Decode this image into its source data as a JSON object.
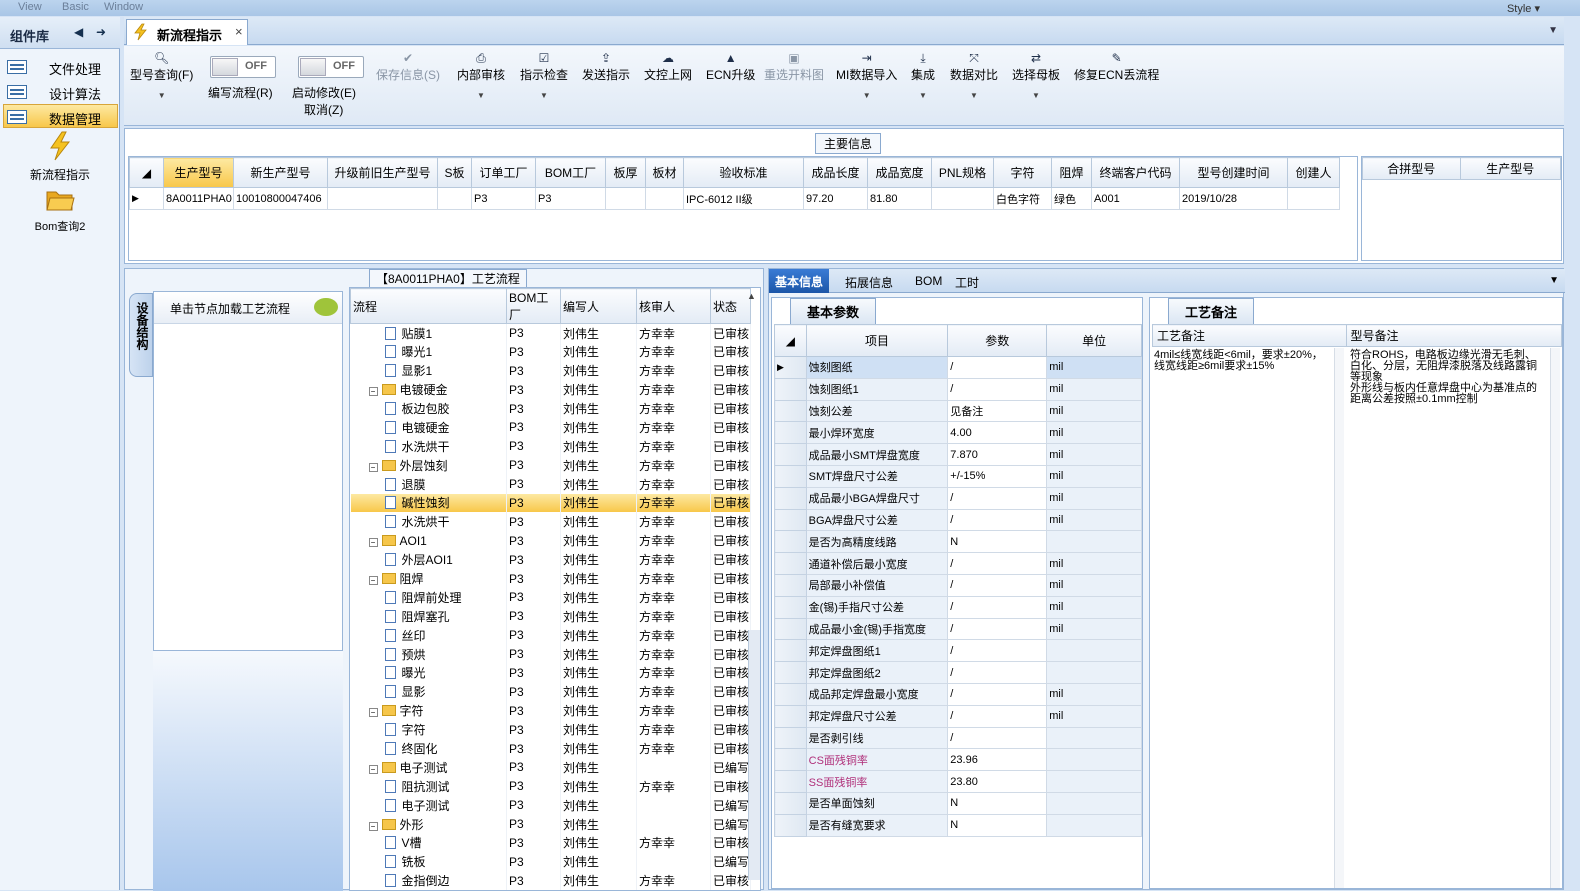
{
  "topbar": {
    "menu": [
      "View",
      "Basic",
      "Window"
    ],
    "style_label": "Style"
  },
  "left_panel": {
    "title": "组件库",
    "items": [
      {
        "label": "文件处理"
      },
      {
        "label": "设计算法"
      },
      {
        "label": "数据管理"
      }
    ],
    "big_items": [
      {
        "label": "新流程指示"
      },
      {
        "label": "Bom查询2"
      }
    ]
  },
  "tab": {
    "label": "新流程指示"
  },
  "toolbar": {
    "buttons": [
      {
        "label": "型号查询(F)"
      },
      {
        "label": "编写流程(R)"
      },
      {
        "label": "启动修改(E)"
      },
      {
        "label": "取消(Z)"
      },
      {
        "label": "保存信息(S)"
      },
      {
        "label": "内部审核"
      },
      {
        "label": "指示检查"
      },
      {
        "label": "发送指示"
      },
      {
        "label": "文控上网"
      },
      {
        "label": "ECN升级"
      },
      {
        "label": "重选开料图"
      },
      {
        "label": "MI数据导入"
      },
      {
        "label": "集成"
      },
      {
        "label": "数据对比"
      },
      {
        "label": "选择母板"
      },
      {
        "label": "修复ECN丢流程"
      }
    ],
    "toggle_state": "OFF"
  },
  "main_info": {
    "legend": "主要信息",
    "columns": [
      "生产型号",
      "新生产型号",
      "升级前旧生产型号",
      "S板",
      "订单工厂",
      "BOM工厂",
      "板厚",
      "板材",
      "验收标准",
      "成品长度",
      "成品宽度",
      "PNL规格",
      "字符",
      "阻焊",
      "终端客户代码",
      "型号创建时间",
      "创建人"
    ],
    "row": [
      "8A0011PHA0",
      "10010800047406",
      "",
      "",
      "P3",
      "P3",
      "",
      "",
      "IPC-6012 II级",
      "97.20",
      "81.80",
      "",
      "白色字符",
      "绿色",
      "A001",
      "2019/10/28",
      ""
    ],
    "side_columns": [
      "合拼型号",
      "生产型号"
    ]
  },
  "process": {
    "legend": "【8A0011PHA0】工艺流程",
    "side_tab": "设备结构",
    "node_hint": "单击节点加载工艺流程",
    "columns": [
      "流程",
      "BOM工厂",
      "编写人",
      "核审人",
      "状态"
    ],
    "rows": [
      {
        "name": "贴膜1",
        "folder": false,
        "bom": "P3",
        "writer": "刘伟生",
        "reviewer": "方幸幸",
        "status": "已审核"
      },
      {
        "name": "曝光1",
        "folder": false,
        "bom": "P3",
        "writer": "刘伟生",
        "reviewer": "方幸幸",
        "status": "已审核"
      },
      {
        "name": "显影1",
        "folder": false,
        "bom": "P3",
        "writer": "刘伟生",
        "reviewer": "方幸幸",
        "status": "已审核"
      },
      {
        "name": "电镀硬金",
        "folder": true,
        "bom": "P3",
        "writer": "刘伟生",
        "reviewer": "方幸幸",
        "status": "已审核"
      },
      {
        "name": "板边包胶",
        "folder": false,
        "bom": "P3",
        "writer": "刘伟生",
        "reviewer": "方幸幸",
        "status": "已审核"
      },
      {
        "name": "电镀硬金",
        "folder": false,
        "bom": "P3",
        "writer": "刘伟生",
        "reviewer": "方幸幸",
        "status": "已审核"
      },
      {
        "name": "水洗烘干",
        "folder": false,
        "bom": "P3",
        "writer": "刘伟生",
        "reviewer": "方幸幸",
        "status": "已审核"
      },
      {
        "name": "外层蚀刻",
        "folder": true,
        "bom": "P3",
        "writer": "刘伟生",
        "reviewer": "方幸幸",
        "status": "已审核"
      },
      {
        "name": "退膜",
        "folder": false,
        "bom": "P3",
        "writer": "刘伟生",
        "reviewer": "方幸幸",
        "status": "已审核"
      },
      {
        "name": "碱性蚀刻",
        "folder": false,
        "bom": "P3",
        "writer": "刘伟生",
        "reviewer": "方幸幸",
        "status": "已审核",
        "selected": true
      },
      {
        "name": "水洗烘干",
        "folder": false,
        "bom": "P3",
        "writer": "刘伟生",
        "reviewer": "方幸幸",
        "status": "已审核"
      },
      {
        "name": "AOI1",
        "folder": true,
        "bom": "P3",
        "writer": "刘伟生",
        "reviewer": "方幸幸",
        "status": "已审核"
      },
      {
        "name": "外层AOI1",
        "folder": false,
        "bom": "P3",
        "writer": "刘伟生",
        "reviewer": "方幸幸",
        "status": "已审核"
      },
      {
        "name": "阻焊",
        "folder": true,
        "bom": "P3",
        "writer": "刘伟生",
        "reviewer": "方幸幸",
        "status": "已审核"
      },
      {
        "name": "阻焊前处理",
        "folder": false,
        "bom": "P3",
        "writer": "刘伟生",
        "reviewer": "方幸幸",
        "status": "已审核"
      },
      {
        "name": "阻焊塞孔",
        "folder": false,
        "bom": "P3",
        "writer": "刘伟生",
        "reviewer": "方幸幸",
        "status": "已审核"
      },
      {
        "name": "丝印",
        "folder": false,
        "bom": "P3",
        "writer": "刘伟生",
        "reviewer": "方幸幸",
        "status": "已审核"
      },
      {
        "name": "预烘",
        "folder": false,
        "bom": "P3",
        "writer": "刘伟生",
        "reviewer": "方幸幸",
        "status": "已审核"
      },
      {
        "name": "曝光",
        "folder": false,
        "bom": "P3",
        "writer": "刘伟生",
        "reviewer": "方幸幸",
        "status": "已审核"
      },
      {
        "name": "显影",
        "folder": false,
        "bom": "P3",
        "writer": "刘伟生",
        "reviewer": "方幸幸",
        "status": "已审核"
      },
      {
        "name": "字符",
        "folder": true,
        "bom": "P3",
        "writer": "刘伟生",
        "reviewer": "方幸幸",
        "status": "已审核"
      },
      {
        "name": "字符",
        "folder": false,
        "bom": "P3",
        "writer": "刘伟生",
        "reviewer": "方幸幸",
        "status": "已审核"
      },
      {
        "name": "终固化",
        "folder": false,
        "bom": "P3",
        "writer": "刘伟生",
        "reviewer": "方幸幸",
        "status": "已审核"
      },
      {
        "name": "电子测试",
        "folder": true,
        "bom": "P3",
        "writer": "刘伟生",
        "reviewer": "",
        "status": "已编写"
      },
      {
        "name": "阻抗测试",
        "folder": false,
        "bom": "P3",
        "writer": "刘伟生",
        "reviewer": "方幸幸",
        "status": "已审核"
      },
      {
        "name": "电子测试",
        "folder": false,
        "bom": "P3",
        "writer": "刘伟生",
        "reviewer": "",
        "status": "已编写"
      },
      {
        "name": "外形",
        "folder": true,
        "bom": "P3",
        "writer": "刘伟生",
        "reviewer": "",
        "status": "已编写"
      },
      {
        "name": "V槽",
        "folder": false,
        "bom": "P3",
        "writer": "刘伟生",
        "reviewer": "方幸幸",
        "status": "已审核"
      },
      {
        "name": "铣板",
        "folder": false,
        "bom": "P3",
        "writer": "刘伟生",
        "reviewer": "",
        "status": "已编写"
      },
      {
        "name": "金指倒边",
        "folder": false,
        "bom": "P3",
        "writer": "刘伟生",
        "reviewer": "方幸幸",
        "status": "已审核"
      }
    ]
  },
  "right": {
    "tabs": [
      "基本信息",
      "拓展信息",
      "BOM",
      "工时"
    ],
    "basic_legend": "基本参数",
    "note_legend": "工艺备注",
    "params_columns": [
      "项目",
      "参数",
      "单位"
    ],
    "params": [
      {
        "item": "蚀刻图纸",
        "value": "/",
        "unit": "mil"
      },
      {
        "item": "蚀刻图纸1",
        "value": "/",
        "unit": "mil"
      },
      {
        "item": "蚀刻公差",
        "value": "见备注",
        "unit": "mil"
      },
      {
        "item": "最小焊环宽度",
        "value": "4.00",
        "unit": "mil"
      },
      {
        "item": "成品最小SMT焊盘宽度",
        "value": "7.870",
        "unit": "mil"
      },
      {
        "item": "SMT焊盘尺寸公差",
        "value": "+/-15%",
        "unit": "mil"
      },
      {
        "item": "成品最小BGA焊盘尺寸",
        "value": "/",
        "unit": "mil"
      },
      {
        "item": "BGA焊盘尺寸公差",
        "value": "/",
        "unit": "mil"
      },
      {
        "item": "是否为高精度线路",
        "value": "N",
        "unit": ""
      },
      {
        "item": "通道补偿后最小宽度",
        "value": "/",
        "unit": "mil"
      },
      {
        "item": "局部最小补偿值",
        "value": "/",
        "unit": "mil"
      },
      {
        "item": "金(锡)手指尺寸公差",
        "value": "/",
        "unit": "mil"
      },
      {
        "item": "成品最小金(锡)手指宽度",
        "value": "/",
        "unit": "mil"
      },
      {
        "item": "邦定焊盘图纸1",
        "value": "/",
        "unit": ""
      },
      {
        "item": "邦定焊盘图纸2",
        "value": "/",
        "unit": ""
      },
      {
        "item": "成品邦定焊盘最小宽度",
        "value": "/",
        "unit": "mil"
      },
      {
        "item": "邦定焊盘尺寸公差",
        "value": "/",
        "unit": "mil"
      },
      {
        "item": "是否剥引线",
        "value": "/",
        "unit": ""
      },
      {
        "item": "CS面残铜率",
        "value": "23.96",
        "unit": "",
        "highlight": true
      },
      {
        "item": "SS面残铜率",
        "value": "23.80",
        "unit": "",
        "highlight": true
      },
      {
        "item": "是否单面蚀刻",
        "value": "N",
        "unit": ""
      },
      {
        "item": "是否有缝宽要求",
        "value": "N",
        "unit": ""
      }
    ],
    "note_columns": [
      "工艺备注",
      "型号备注"
    ],
    "process_note": "4mil≤线宽线距<6mil，要求±20%，线宽线距≥6mil要求±15%",
    "model_note": "符合ROHS，电路板边缘光滑无毛刺、白化、分层，无阻焊漆脱落及线路露铜等现象\n外形线与板内任意焊盘中心为基准点的距离公差按照±0.1mm控制"
  }
}
